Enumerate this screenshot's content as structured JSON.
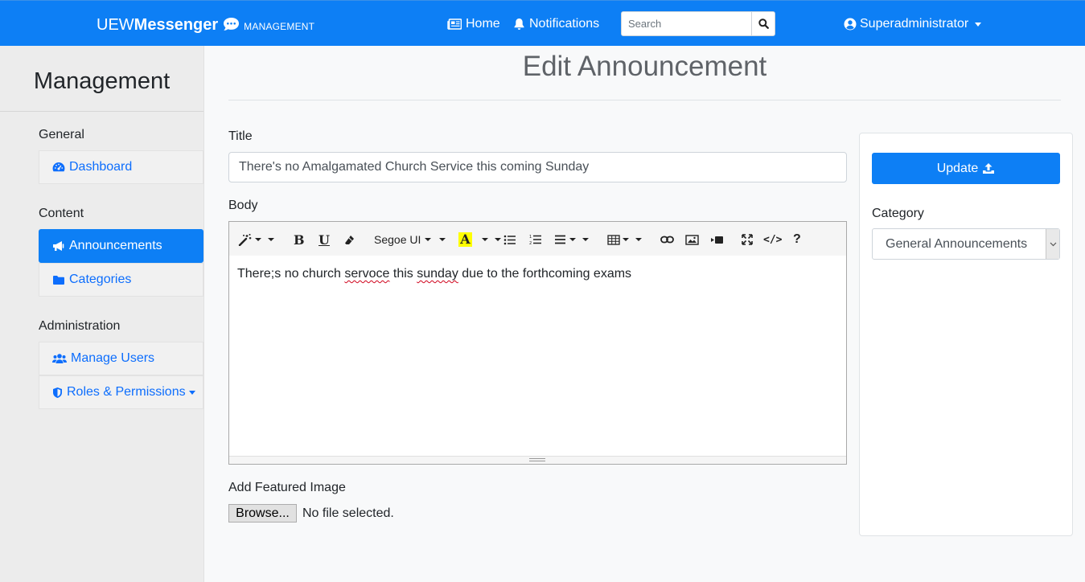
{
  "navbar": {
    "brand_prefix": "UEW",
    "brand_main": "Messenger",
    "brand_suffix": "MANAGEMENT",
    "home_label": "Home",
    "notifications_label": "Notifications",
    "search_placeholder": "Search",
    "user_label": "Superadministrator",
    "icons": [
      "comment-icon",
      "newspaper-icon",
      "bell-icon",
      "search-icon",
      "user-circle-icon"
    ]
  },
  "sidebar": {
    "title": "Management",
    "sections": {
      "general": "General",
      "content": "Content",
      "administration": "Administration"
    },
    "items": [
      {
        "label": "Dashboard",
        "icon": "tachometer-icon",
        "active": false
      },
      {
        "label": "Announcements",
        "icon": "bullhorn-icon",
        "active": true
      },
      {
        "label": "Categories",
        "icon": "folder-icon",
        "active": false
      },
      {
        "label": "Manage Users",
        "icon": "users-icon",
        "active": false
      },
      {
        "label": "Roles & Permissions",
        "icon": "shield-icon",
        "active": false
      }
    ]
  },
  "main": {
    "page_title": "Edit Announcement",
    "title_label": "Title",
    "title_value": "There's no Amalgamated Church Service this coming Sunday",
    "body_label": "Body",
    "editor": {
      "font_name": "Segoe UI",
      "body_parts": [
        "There;s no church ",
        "servoce",
        " this ",
        "sunday",
        " due to the forthcoming exams"
      ],
      "toolbar_icons": [
        "magic-icon",
        "bold-icon",
        "underline-icon",
        "eraser-icon",
        "font-name-dropdown",
        "highlight-icon",
        "unordered-list-icon",
        "ordered-list-icon",
        "align-icon",
        "table-icon",
        "link-icon",
        "image-icon",
        "video-icon",
        "fullscreen-icon",
        "code-view-icon",
        "help-icon"
      ]
    },
    "featured_image_label": "Add Featured Image",
    "browse_label": "Browse...",
    "no_file_label": "No file selected."
  },
  "panel": {
    "update_label": "Update",
    "category_label": "Category",
    "category_value": "General Announcements"
  },
  "colors": {
    "primary": "#0d7ff5",
    "link": "#0d6efd",
    "sidebar_bg": "#ececec",
    "page_bg": "#f8f9fa"
  }
}
